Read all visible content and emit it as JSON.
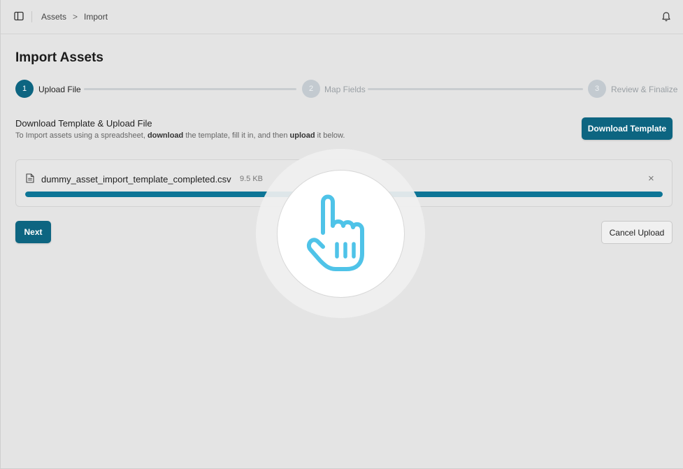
{
  "breadcrumb": {
    "items": [
      "Assets",
      "Import"
    ],
    "separator": ">"
  },
  "page": {
    "title": "Import Assets"
  },
  "stepper": {
    "steps": [
      {
        "number": "1",
        "label": "Upload File",
        "state": "active"
      },
      {
        "number": "2",
        "label": "Map Fields",
        "state": "inactive"
      },
      {
        "number": "3",
        "label": "Review & Finalize",
        "state": "inactive"
      }
    ]
  },
  "upload_section": {
    "title": "Download Template & Upload File",
    "desc_part1": "To Import assets using a spreadsheet, ",
    "desc_bold1": "download",
    "desc_part2": " the template, fill it in, and then ",
    "desc_bold2": "upload",
    "desc_part3": " it below.",
    "download_button": "Download Template"
  },
  "file": {
    "name": "dummy_asset_import_template_completed.csv",
    "size": "9.5 KB",
    "progress": 1.0
  },
  "actions": {
    "next_label": "Next",
    "cancel_label": "Cancel Upload"
  },
  "colors": {
    "accent": "#0d6581",
    "progress": "#0d7596",
    "click_indicator": "#4fc3e8"
  },
  "icons": [
    "sidebar-toggle-icon",
    "bell-icon",
    "file-icon",
    "close-icon",
    "pointer-hand-icon"
  ]
}
